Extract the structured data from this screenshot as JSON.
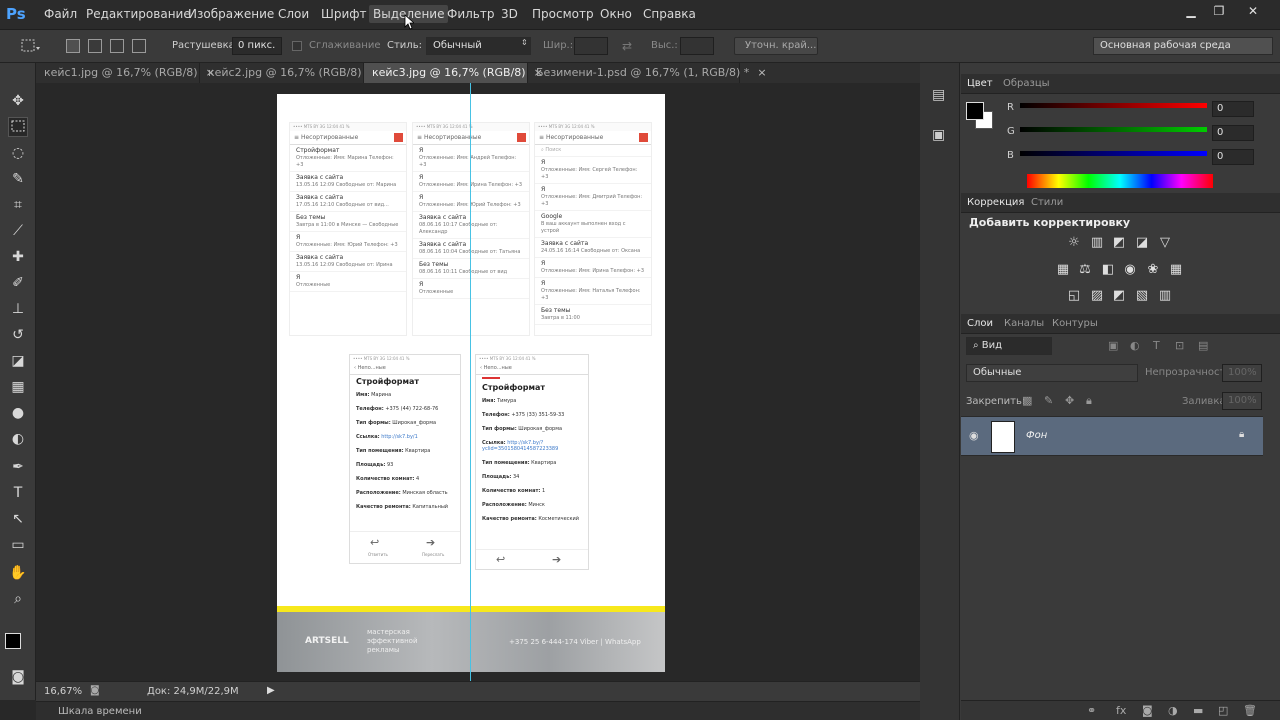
{
  "menu": {
    "logo": "Ps",
    "items": [
      "Файл",
      "Редактирование",
      "Изображение",
      "Слои",
      "Шрифт",
      "Выделение",
      "Фильтр",
      "3D",
      "Просмотр",
      "Окно",
      "Справка"
    ],
    "active": "Выделение",
    "min": "▁",
    "restore": "❐",
    "close": "✕"
  },
  "options": {
    "feather_label": "Растушевка:",
    "feather_value": "0 пикс.",
    "antialias_label": "Сглаживание",
    "style_label": "Стиль:",
    "style_value": "Обычный",
    "width_label": "Шир.:",
    "height_label": "Выс.:",
    "refine_label": "Уточн. край...",
    "workspace": "Основная рабочая среда"
  },
  "tabs": [
    {
      "label": "кейс1.jpg @ 16,7% (RGB/8)"
    },
    {
      "label": "кейс2.jpg @ 16,7% (RGB/8)"
    },
    {
      "label": "кейс3.jpg @ 16,7% (RGB/8)"
    },
    {
      "label": "Безимени-1.psd @ 16,7% (1, RGB/8) *"
    }
  ],
  "tab_close": "×",
  "status": {
    "zoom": "16,67%",
    "doc": "Док: 24,9M/22,9M",
    "timeline": "Шкала времени"
  },
  "color_panel": {
    "tab1": "Цвет",
    "tab2": "Образцы",
    "r_label": "R",
    "g_label": "G",
    "b_label": "B",
    "r": "0",
    "g": "0",
    "b": "0"
  },
  "adjust_panel": {
    "tab1": "Коррекция",
    "tab2": "Стили",
    "title": "Добавить корректировку"
  },
  "layers_panel": {
    "tab1": "Слои",
    "tab2": "Каналы",
    "tab3": "Контуры",
    "filter": "Вид",
    "blend": "Обычные",
    "opacity_label": "Непрозрачность:",
    "opacity": "100%",
    "lock_label": "Закрепить:",
    "fill_label": "Заливка:",
    "fill": "100%",
    "layer_name": "Фон"
  },
  "doc": {
    "list_header": "Несортированные",
    "search": "Поиск",
    "phone_status": "•••• MTS BY  3G     12:04       41 %",
    "list1": [
      {
        "t": "Стройформат",
        "s": "Отложенные: Имя: Марина Телефон: +3"
      },
      {
        "t": "Заявка с сайта",
        "s": "13.05.16 12:09 Свободные от: Марина"
      },
      {
        "t": "Заявка с сайта",
        "s": "17.05.16 12:10 Свободные от вид..."
      },
      {
        "t": "Без темы",
        "s": "Завтра в 11:00 в Минске — Свободные"
      },
      {
        "t": "Я",
        "s": "Отложенные: Имя: Юрий Телефон: +3"
      },
      {
        "t": "Заявка с сайта",
        "s": "13.05.16 12:09 Свободные от: Ирина"
      },
      {
        "t": "Я",
        "s": "Отложенные"
      }
    ],
    "list2": [
      {
        "t": "Я",
        "s": "Отложенные: Имя: Андрей Телефон: +3"
      },
      {
        "t": "Я",
        "s": "Отложенные: Имя: Ирина Телефон: +3"
      },
      {
        "t": "Я",
        "s": "Отложенные: Имя: Юрий Телефон: +3"
      },
      {
        "t": "Заявка с сайта",
        "s": "08.06.16 10:17 Свободные от: Александр"
      },
      {
        "t": "Заявка с сайта",
        "s": "08.06.16 10:04 Свободные от: Татьяна"
      },
      {
        "t": "Без темы",
        "s": "08.06.16 10:11 Свободные от вид"
      },
      {
        "t": "Я",
        "s": "Отложенные"
      }
    ],
    "list3": [
      {
        "t": "Я",
        "s": "Отложенные: Имя: Сергей Телефон: +3"
      },
      {
        "t": "Я",
        "s": "Отложенные: Имя: Дмитрий Телефон: +3"
      },
      {
        "t": "Google",
        "s": "В ваш аккаунт выполнен вход с устрой"
      },
      {
        "t": "Заявка с сайта",
        "s": "24.05.16 16:14 Свободные от: Оксана"
      },
      {
        "t": "Я",
        "s": "Отложенные: Имя: Ирина Телефон: +3"
      },
      {
        "t": "Я",
        "s": "Отложенные: Имя: Наталья Телефон: +3"
      },
      {
        "t": "Без темы",
        "s": "Завтра в 11:00"
      }
    ],
    "detail1": {
      "nav": "Непо...ные",
      "title": "Стройформат",
      "lines": [
        {
          "k": "Имя:",
          "v": "Марина"
        },
        {
          "k": "Телефон:",
          "v": "+375 (44) 722-68-76"
        },
        {
          "k": "Тип формы:",
          "v": "Широкая_форма"
        },
        {
          "k": "Ссылка:",
          "v": "http://sk7.by/1"
        },
        {
          "k": "Тип помещения:",
          "v": "Квартира"
        },
        {
          "k": "Площадь:",
          "v": "93"
        },
        {
          "k": "Количество комнат:",
          "v": "4"
        },
        {
          "k": "Расположение:",
          "v": "Минская область"
        },
        {
          "k": "Качество ремонта:",
          "v": "Капитальный"
        }
      ],
      "reply": "Ответить",
      "forward": "Переслать"
    },
    "detail2": {
      "nav": "Непо...ные",
      "title": "Стройформат",
      "lines": [
        {
          "k": "Имя:",
          "v": "Тимура"
        },
        {
          "k": "Телефон:",
          "v": "+375 (33) 351-59-33"
        },
        {
          "k": "Тип формы:",
          "v": "Широкая_форма"
        },
        {
          "k": "Ссылка:",
          "v": "http://sk7.by/?yclid=3501580414587223389"
        },
        {
          "k": "Тип помещения:",
          "v": "Квартира"
        },
        {
          "k": "Площадь:",
          "v": "34"
        },
        {
          "k": "Количество комнат:",
          "v": "1"
        },
        {
          "k": "Расположение:",
          "v": "Минск"
        },
        {
          "k": "Качество ремонта:",
          "v": "Косметический"
        }
      ]
    },
    "footer_brand": "ARTSELL",
    "footer_slogan": "мастерская эффективной рекламы",
    "footer_contacts": "+375 25 6-444-174 Viber | WhatsApp"
  },
  "colors": {
    "accent_yellow": "#f7e81c",
    "guide": "#47c2e4",
    "layer_selected": "#5b6a7e"
  }
}
